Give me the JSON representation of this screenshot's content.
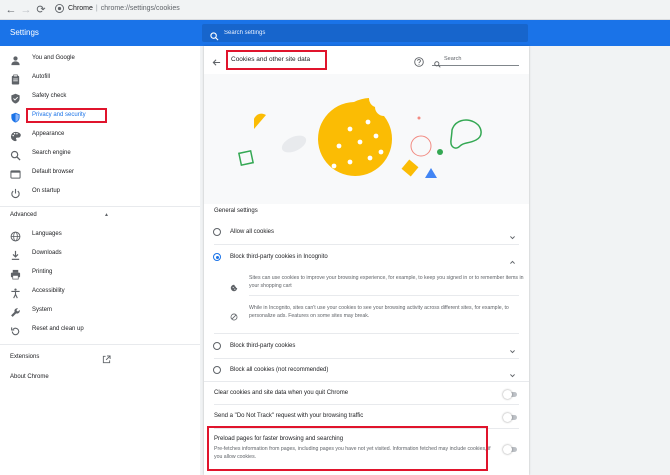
{
  "browser": {
    "site_label": "Chrome",
    "url_path": "chrome://settings/cookies"
  },
  "header": {
    "title": "Settings",
    "search_placeholder": "Search settings"
  },
  "sidebar": {
    "items": [
      {
        "label": "You and Google",
        "icon": "person-icon"
      },
      {
        "label": "Autofill",
        "icon": "clipboard-icon"
      },
      {
        "label": "Safety check",
        "icon": "shield-check-icon"
      },
      {
        "label": "Privacy and security",
        "icon": "shield-icon",
        "active": true
      },
      {
        "label": "Appearance",
        "icon": "palette-icon"
      },
      {
        "label": "Search engine",
        "icon": "search-icon"
      },
      {
        "label": "Default browser",
        "icon": "browser-icon"
      },
      {
        "label": "On startup",
        "icon": "power-icon"
      }
    ],
    "advanced_label": "Advanced",
    "advanced_items": [
      {
        "label": "Languages",
        "icon": "globe-icon"
      },
      {
        "label": "Downloads",
        "icon": "download-icon"
      },
      {
        "label": "Printing",
        "icon": "printer-icon"
      },
      {
        "label": "Accessibility",
        "icon": "accessibility-icon"
      },
      {
        "label": "System",
        "icon": "wrench-icon"
      },
      {
        "label": "Reset and clean up",
        "icon": "reset-icon"
      }
    ],
    "extensions_label": "Extensions",
    "about_label": "About Chrome"
  },
  "main": {
    "title": "Cookies and other site data",
    "search_placeholder": "Search",
    "general_settings_label": "General settings",
    "options": [
      {
        "label": "Allow all cookies",
        "selected": false
      },
      {
        "label": "Block third-party cookies in Incognito",
        "selected": true
      },
      {
        "label": "Block third-party cookies",
        "selected": false
      },
      {
        "label": "Block all cookies (not recommended)",
        "selected": false
      }
    ],
    "incognito_details": [
      "Sites can use cookies to improve your browsing experience, for example, to keep you signed in or to remember items in your shopping cart",
      "While in Incognito, sites can't use your cookies to see your browsing activity across different sites, for example, to personalize ads. Features on some sites may break."
    ],
    "toggles": [
      {
        "label": "Clear cookies and site data when you quit Chrome",
        "on": false
      },
      {
        "label": "Send a \"Do Not Track\" request with your browsing traffic",
        "on": false
      },
      {
        "label": "Preload pages for faster browsing and searching",
        "sub": "Pre-fetches information from pages, including pages you have not yet visited. Information fetched may include cookies, if you allow cookies.",
        "on": false
      }
    ]
  },
  "colors": {
    "accent": "#1a73e8",
    "highlight": "#e0142c",
    "cookie": "#fbbc04"
  }
}
